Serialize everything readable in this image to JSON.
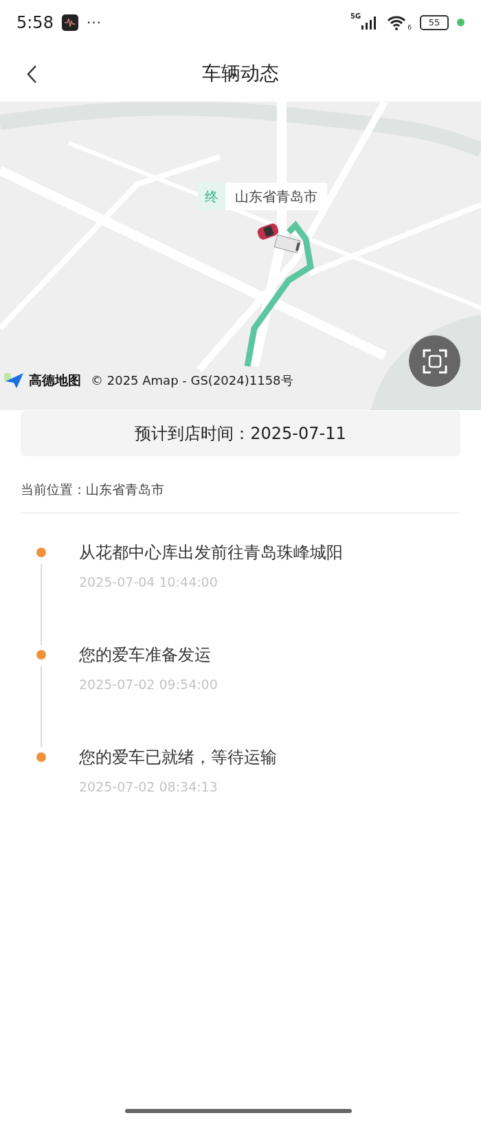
{
  "status_bar": {
    "time": "5:58",
    "more": "···",
    "network": "5G",
    "wifi_band": "6",
    "battery": "55"
  },
  "header": {
    "title": "车辆动态"
  },
  "map": {
    "end_marker": {
      "badge": "终",
      "label": "山东省青岛市"
    },
    "logo": "高德地图",
    "copyright": "© 2025 Amap - GS(2024)1158号"
  },
  "eta": {
    "text": "预计到店时间：2025-07-11"
  },
  "location": {
    "text": "当前位置：山东省青岛市"
  },
  "events": [
    {
      "title": "从花都中心库出发前往青岛珠峰城阳",
      "time": "2025-07-04 10:44:00"
    },
    {
      "title": "您的爱车准备发运",
      "time": "2025-07-02 09:54:00"
    },
    {
      "title": "您的爱车已就绪，等待运输",
      "time": "2025-07-02 08:34:13"
    }
  ]
}
